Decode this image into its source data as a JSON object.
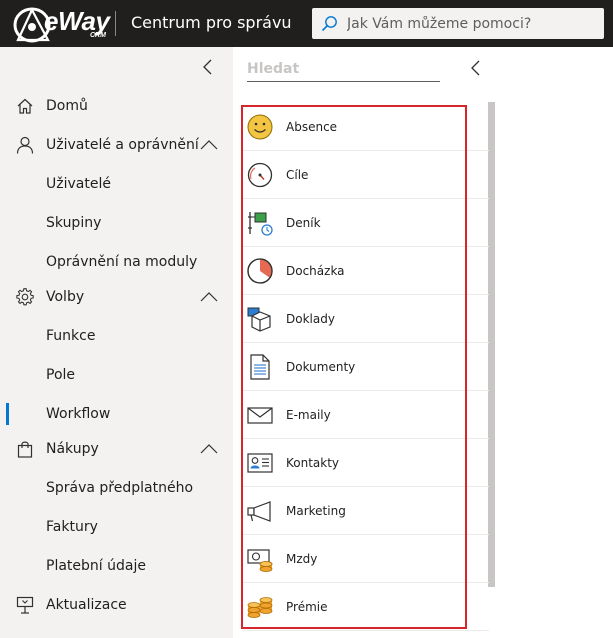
{
  "header": {
    "logo_text": "eWay",
    "logo_sub": "CRM",
    "app_title": "Centrum pro správu",
    "search_placeholder": "Jak Vám můžeme pomoci?"
  },
  "leftnav": {
    "items": [
      {
        "label": "Domů",
        "icon": "home-icon",
        "level": 0
      },
      {
        "label": "Uživatelé a oprávnění",
        "icon": "user-icon",
        "level": 0,
        "expanded": true
      },
      {
        "label": "Uživatelé",
        "level": 1
      },
      {
        "label": "Skupiny",
        "level": 1
      },
      {
        "label": "Oprávnění na moduly",
        "level": 1
      },
      {
        "label": "Volby",
        "icon": "gear-icon",
        "level": 0,
        "expanded": true
      },
      {
        "label": "Funkce",
        "level": 1
      },
      {
        "label": "Pole",
        "level": 1
      },
      {
        "label": "Workflow",
        "level": 1,
        "active": true
      },
      {
        "label": "Nákupy",
        "icon": "shopping-bag-icon",
        "level": 0,
        "expanded": true
      },
      {
        "label": "Správa předplatného",
        "level": 1
      },
      {
        "label": "Faktury",
        "level": 1
      },
      {
        "label": "Platební údaje",
        "level": 1
      },
      {
        "label": "Aktualizace",
        "icon": "update-icon",
        "level": 0
      }
    ]
  },
  "midpanel": {
    "search_placeholder": "Hledat",
    "modules": [
      {
        "label": "Absence",
        "icon": "smiley-icon"
      },
      {
        "label": "Cíle",
        "icon": "gauge-icon"
      },
      {
        "label": "Deník",
        "icon": "journal-icon"
      },
      {
        "label": "Docházka",
        "icon": "clock-pie-icon"
      },
      {
        "label": "Doklady",
        "icon": "box-icon"
      },
      {
        "label": "Dokumenty",
        "icon": "document-icon"
      },
      {
        "label": "E-maily",
        "icon": "envelope-icon"
      },
      {
        "label": "Kontakty",
        "icon": "contact-card-icon"
      },
      {
        "label": "Marketing",
        "icon": "megaphone-icon"
      },
      {
        "label": "Mzdy",
        "icon": "salary-icon"
      },
      {
        "label": "Prémie",
        "icon": "coins-icon"
      }
    ]
  },
  "colors": {
    "header_bg": "#201f1e",
    "nav_bg": "#f3f2f1",
    "highlight_frame": "#d7262b",
    "active_indicator": "#0078d4"
  }
}
